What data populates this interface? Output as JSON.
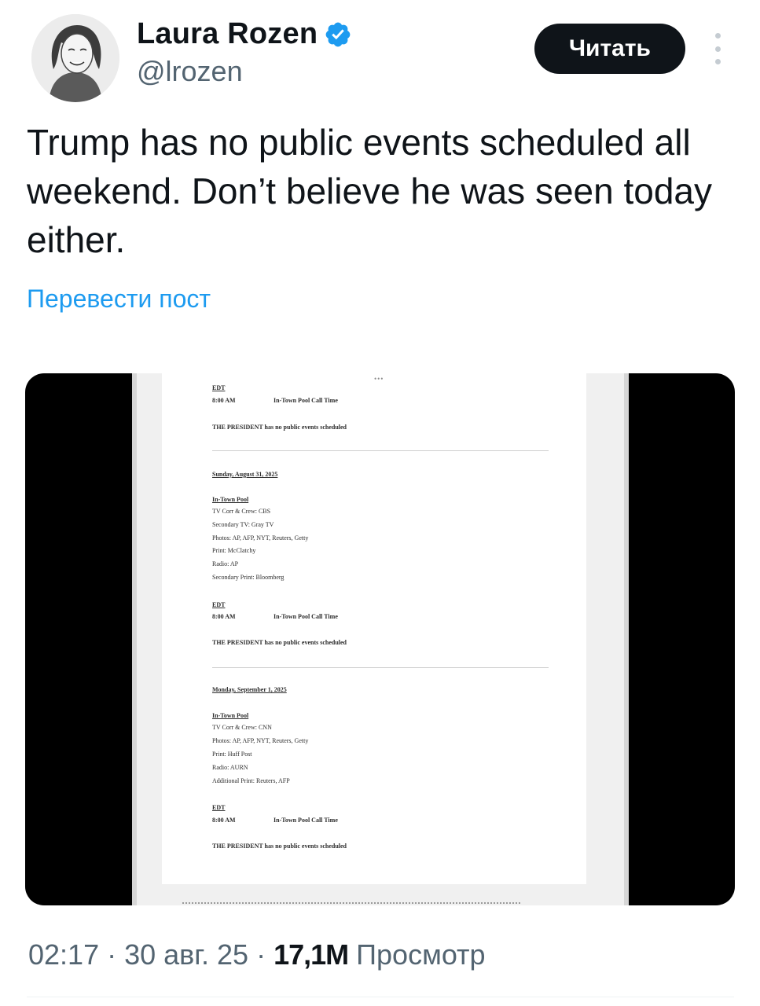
{
  "author": {
    "display_name": "Laura Rozen",
    "handle": "@lrozen",
    "verified_icon": "verified-badge-icon",
    "avatar_icon": "avatar-portrait"
  },
  "header": {
    "follow_label": "Читать",
    "more_icon": "more-vertical-icon"
  },
  "tweet": {
    "text": "Trump has no public events scheduled all weekend. Don’t believe he was seen today either.",
    "translate_label": "Перевести пост"
  },
  "media": {
    "top_dots": "•••",
    "blocks": [
      {
        "tz": "EDT",
        "time": "8:00 AM",
        "time_label": "In-Town Pool Call Time",
        "president": "THE PRESIDENT has no public events scheduled"
      },
      {
        "date": "Sunday, August 31, 2025",
        "pool_title": "In-Town Pool",
        "pool_lines": [
          "TV Corr & Crew: CBS",
          "Secondary TV: Gray TV",
          "Photos: AP, AFP, NYT, Reuters, Getty",
          "Print: McClatchy",
          "Radio: AP",
          "Secondary Print: Bloomberg"
        ],
        "tz": "EDT",
        "time": "8:00 AM",
        "time_label": "In-Town Pool Call Time",
        "president": "THE PRESIDENT has no public events scheduled"
      },
      {
        "date": "Monday, September 1, 2025",
        "pool_title": "In-Town Pool",
        "pool_lines": [
          "TV Corr & Crew: CNN",
          "Photos: AP, AFP, NYT, Reuters, Getty",
          "Print: Huff Post",
          "Radio: AURN",
          "Additional Print: Reuters, AFP"
        ],
        "tz": "EDT",
        "time": "8:00 AM",
        "time_label": "In-Town Pool Call Time",
        "president": "THE PRESIDENT has no public events scheduled"
      }
    ]
  },
  "meta": {
    "time": "02:17",
    "separator": " · ",
    "date": "30 авг. 25",
    "views_count": "17,1M",
    "views_label": "Просмотр"
  }
}
